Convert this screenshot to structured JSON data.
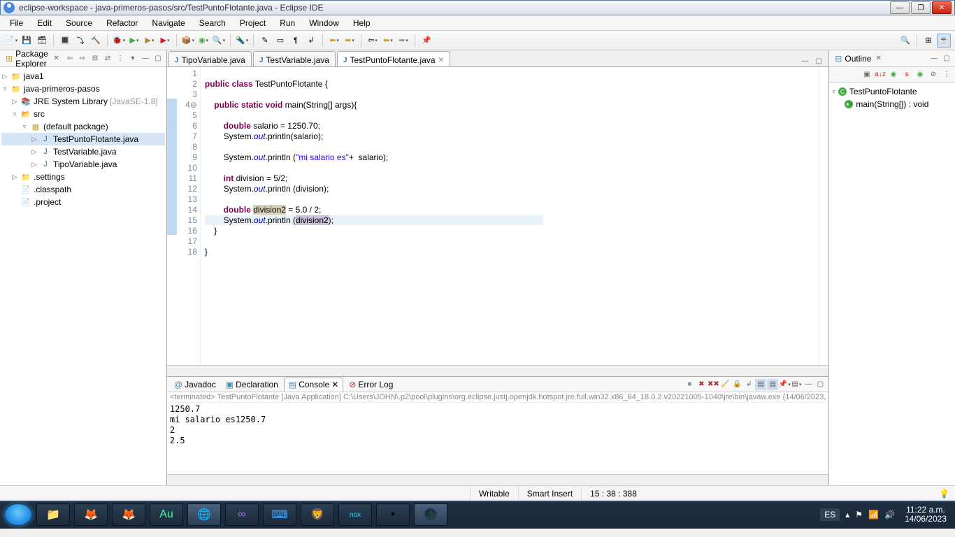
{
  "window": {
    "title": "eclipse-workspace - java-primeros-pasos/src/TestPuntoFlotante.java - Eclipse IDE"
  },
  "menu": [
    "File",
    "Edit",
    "Source",
    "Refactor",
    "Navigate",
    "Search",
    "Project",
    "Run",
    "Window",
    "Help"
  ],
  "packageExplorer": {
    "title": "Package Explorer",
    "nodes": {
      "java1": "java1",
      "proj": "java-primeros-pasos",
      "jre": "JRE System Library",
      "jreTag": "[JavaSE-1.8]",
      "src": "src",
      "pkg": "(default package)",
      "f1": "TestPuntoFlotante.java",
      "f2": "TestVariable.java",
      "f3": "TipoVariable.java",
      "settings": ".settings",
      "classpath": ".classpath",
      "project": ".project"
    }
  },
  "tabs": {
    "t1": "TipoVariable.java",
    "t2": "TestVariable.java",
    "t3": "TestPuntoFlotante.java"
  },
  "code": {
    "lines": [
      "1",
      "2",
      "3",
      "4",
      "5",
      "6",
      "7",
      "8",
      "9",
      "10",
      "11",
      "12",
      "13",
      "14",
      "15",
      "16",
      "17",
      "18"
    ]
  },
  "outline": {
    "title": "Outline",
    "class": "TestPuntoFlotante",
    "method": "main(String[]) : void"
  },
  "bottomTabs": {
    "javadoc": "Javadoc",
    "decl": "Declaration",
    "console": "Console",
    "err": "Error Log"
  },
  "terminated": "<terminated> TestPuntoFlotante [Java Application] C:\\Users\\JOHN\\.p2\\pool\\plugins\\org.eclipse.justj.openjdk.hotspot.jre.full.win32.x86_64_18.0.2.v20221005-1040\\jre\\bin\\javaw.exe  (14/06/2023,",
  "consoleOut": "1250.7\nmi salario es1250.7\n2\n2.5",
  "status": {
    "writable": "Writable",
    "insert": "Smart Insert",
    "pos": "15 : 38 : 388"
  },
  "tray": {
    "lang": "ES",
    "time": "11:22 a.m.",
    "date": "14/06/2023"
  }
}
